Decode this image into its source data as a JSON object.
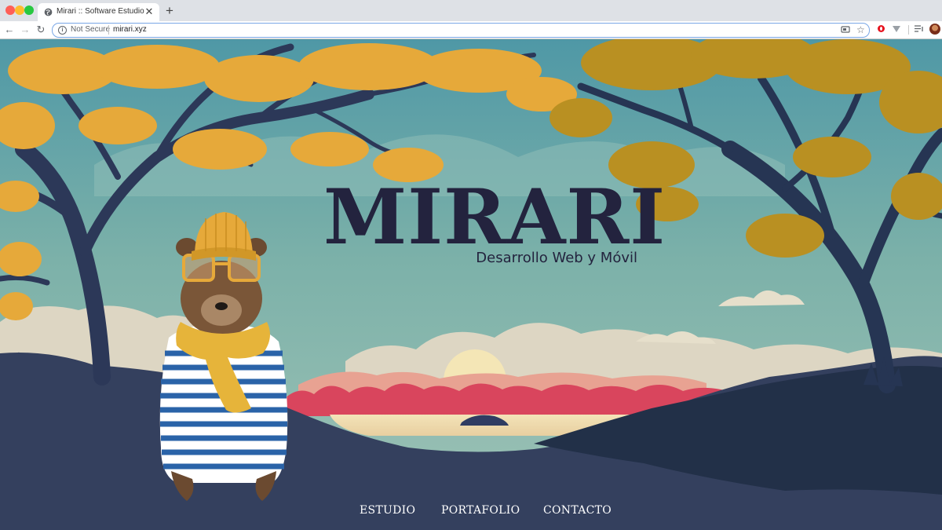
{
  "browser": {
    "tab": {
      "title": "Mirari :: Software Estudio",
      "close_label": "✕"
    },
    "new_tab_label": "+",
    "toolbar": {
      "back_label": "←",
      "forward_label": "→",
      "reload_label": "↻",
      "security_label": "Not Secure",
      "url": "mirari.xyz"
    }
  },
  "hero": {
    "title": "MIRARI",
    "subtitle": "Desarrollo Web y Móvil"
  },
  "nav": {
    "items": [
      {
        "label": "ESTUDIO"
      },
      {
        "label": "PORTAFOLIO"
      },
      {
        "label": "CONTACTO"
      }
    ]
  },
  "colors": {
    "sky": "#7fb3ad",
    "foliage": "#e6a93a",
    "tree": "#2e3b5c",
    "ground": "#34405e",
    "sunset": "#e04e6b",
    "logo_text": "#23233e"
  },
  "icons": [
    "globe-icon",
    "info-icon",
    "cast-icon",
    "star-icon",
    "opera-icon",
    "vpn-icon",
    "playlist-icon",
    "avatar"
  ]
}
